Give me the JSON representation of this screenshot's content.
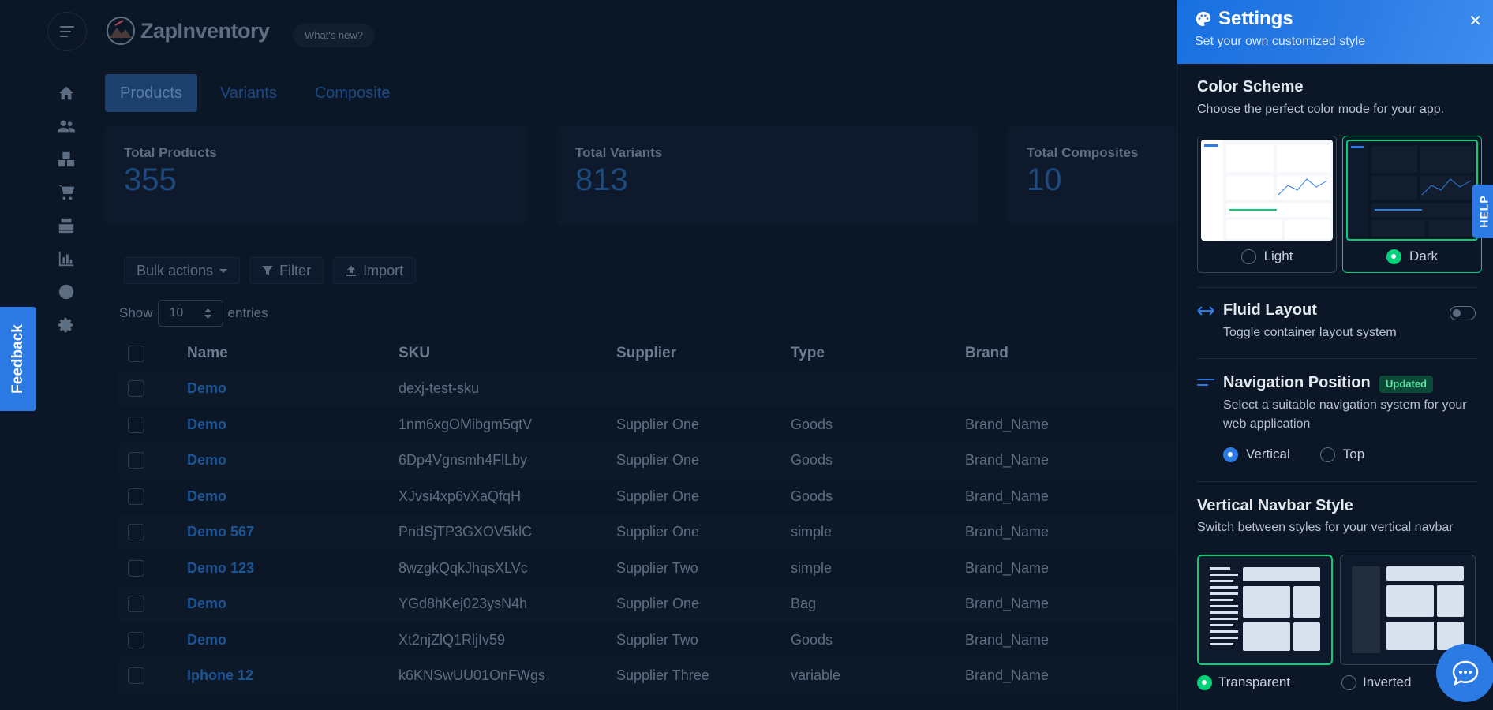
{
  "app": {
    "brand": "ZapInventory",
    "whats_new": "What's new?"
  },
  "tabs": [
    "Products",
    "Variants",
    "Composite"
  ],
  "stats": [
    {
      "label": "Total Products",
      "value": "355"
    },
    {
      "label": "Total Variants",
      "value": "813"
    },
    {
      "label": "Total Composites",
      "value": "10"
    }
  ],
  "actions": {
    "bulk": "Bulk actions",
    "filter": "Filter",
    "import": "Import"
  },
  "entries": {
    "show": "Show",
    "value": "10",
    "suffix": "entries"
  },
  "table": {
    "columns": [
      "Name",
      "SKU",
      "Supplier",
      "Type",
      "Brand"
    ],
    "rows": [
      {
        "name": "Demo",
        "sku": "dexj-test-sku",
        "supplier": "",
        "type": "",
        "brand": ""
      },
      {
        "name": "Demo",
        "sku": "1nm6xgOMibgm5qtV",
        "supplier": "Supplier One",
        "type": "Goods",
        "brand": "Brand_Name"
      },
      {
        "name": "Demo",
        "sku": "6Dp4Vgnsmh4FlLby",
        "supplier": "Supplier One",
        "type": "Goods",
        "brand": "Brand_Name"
      },
      {
        "name": "Demo",
        "sku": "XJvsi4xp6vXaQfqH",
        "supplier": "Supplier One",
        "type": "Goods",
        "brand": "Brand_Name"
      },
      {
        "name": "Demo 567",
        "sku": "PndSjTP3GXOV5klC",
        "supplier": "Supplier One",
        "type": "simple",
        "brand": "Brand_Name"
      },
      {
        "name": "Demo 123",
        "sku": "8wzgkQqkJhqsXLVc",
        "supplier": "Supplier Two",
        "type": "simple",
        "brand": "Brand_Name"
      },
      {
        "name": "Demo",
        "sku": "YGd8hKej023ysN4h",
        "supplier": "Supplier One",
        "type": "Bag",
        "brand": "Brand_Name"
      },
      {
        "name": "Demo",
        "sku": "Xt2njZlQ1RljIv59",
        "supplier": "Supplier Two",
        "type": "Goods",
        "brand": "Brand_Name"
      },
      {
        "name": "Iphone 12",
        "sku": "k6KNSwUU01OnFWgs",
        "supplier": "Supplier Three",
        "type": "variable",
        "brand": "Brand_Name"
      }
    ]
  },
  "feedback": "Feedback",
  "help": "HELP",
  "settings": {
    "title": "Settings",
    "subtitle": "Set your own customized style",
    "color_scheme": {
      "title": "Color Scheme",
      "desc": "Choose the perfect color mode for your app.",
      "light": "Light",
      "dark": "Dark",
      "selected": "dark"
    },
    "fluid": {
      "title": "Fluid Layout",
      "desc": "Toggle container layout system",
      "enabled": false
    },
    "nav_position": {
      "title": "Navigation Position",
      "badge": "Updated",
      "desc": "Select a suitable navigation system for your web application",
      "vertical": "Vertical",
      "top": "Top",
      "selected": "vertical"
    },
    "navbar_style": {
      "title": "Vertical Navbar Style",
      "desc": "Switch between styles for your vertical navbar",
      "transparent": "Transparent",
      "inverted": "Inverted",
      "selected": "transparent"
    }
  },
  "colors": {
    "primary": "#2c7be5",
    "success": "#00d27a",
    "bg": "#0b1727"
  }
}
